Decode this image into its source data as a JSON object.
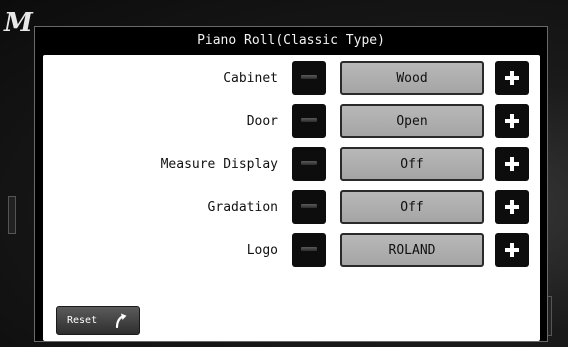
{
  "dialog": {
    "title": "Piano Roll(Classic Type)"
  },
  "background": {
    "logo_glyph": "M"
  },
  "settings": [
    {
      "label": "Cabinet",
      "value": "Wood"
    },
    {
      "label": "Door",
      "value": "Open"
    },
    {
      "label": "Measure Display",
      "value": "Off"
    },
    {
      "label": "Gradation",
      "value": "Off"
    },
    {
      "label": "Logo",
      "value": "ROLAND"
    }
  ],
  "reset": {
    "label": "Reset"
  },
  "icons": {
    "decrement": "minus-icon",
    "increment": "plus-icon",
    "reset": "undo-arrow-icon"
  },
  "colors": {
    "dialog_bg": "#000000",
    "panel_bg": "#ffffff",
    "value_bg": "#b0b0b0",
    "button_bg": "#0d0d0d"
  }
}
